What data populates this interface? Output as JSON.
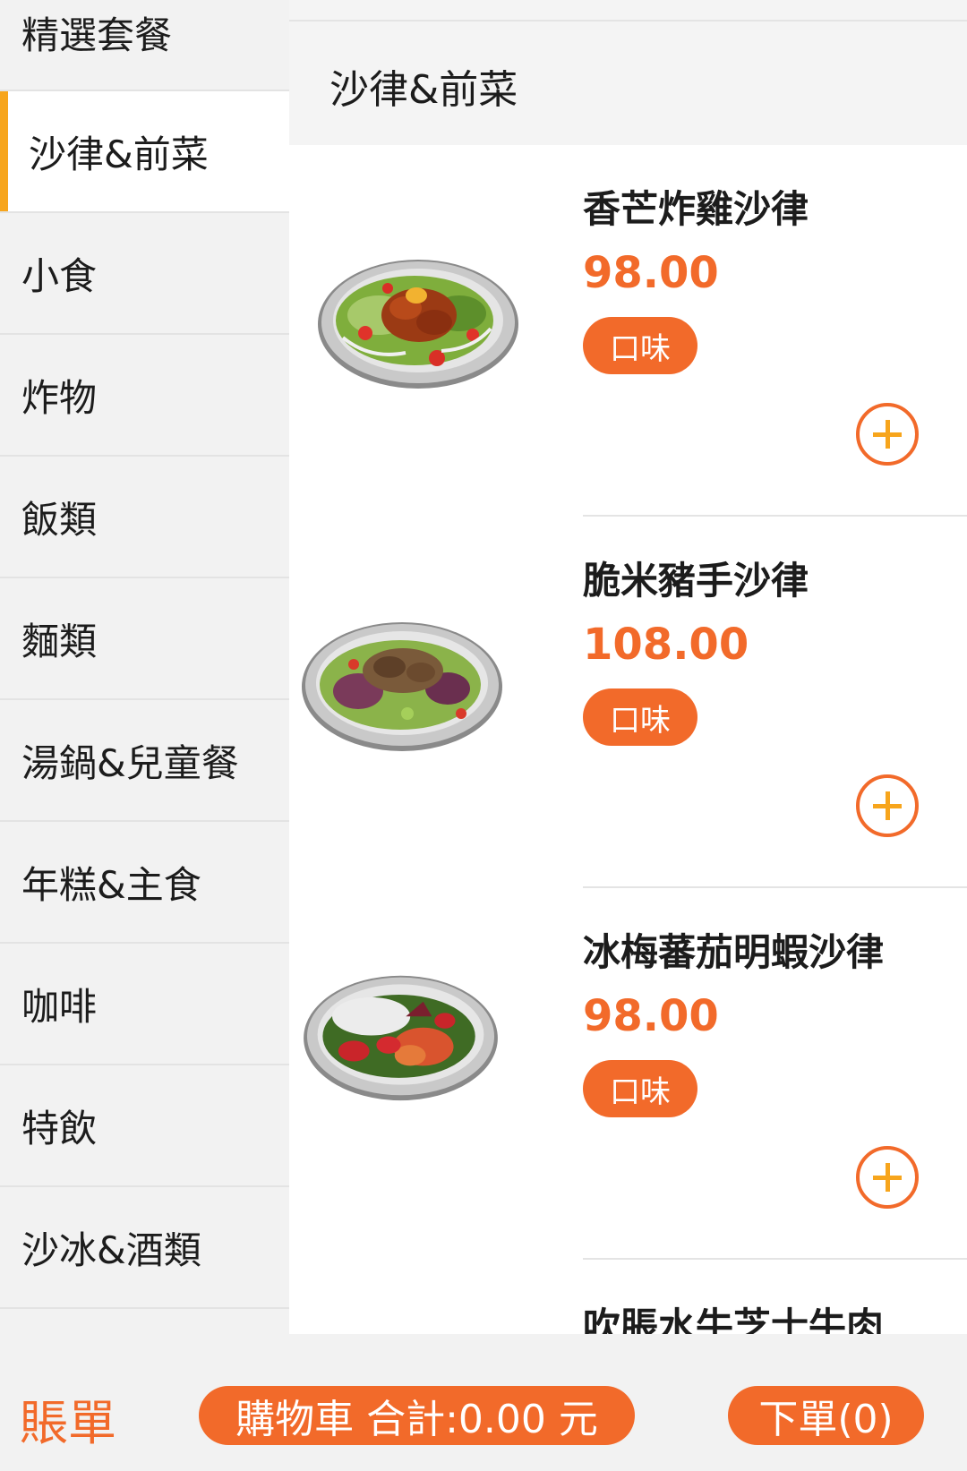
{
  "sidebar": {
    "items": [
      {
        "label": "精選套餐"
      },
      {
        "label": "沙律&前菜"
      },
      {
        "label": "小食"
      },
      {
        "label": "炸物"
      },
      {
        "label": "飯類"
      },
      {
        "label": "麵類"
      },
      {
        "label": "湯鍋&兒童餐"
      },
      {
        "label": "年糕&主食"
      },
      {
        "label": "咖啡"
      },
      {
        "label": "特飲"
      },
      {
        "label": "沙冰&酒類"
      }
    ],
    "active_index": 1
  },
  "section": {
    "title": "沙律&前菜"
  },
  "products": [
    {
      "name": "香芒炸雞沙律",
      "price": "98.00",
      "flavor_label": "口味",
      "image": "salad-fried-chicken-mango"
    },
    {
      "name": "脆米豬手沙律",
      "price": "108.00",
      "flavor_label": "口味",
      "image": "salad-pork-knuckle"
    },
    {
      "name": "冰梅蕃茄明蝦沙律",
      "price": "98.00",
      "flavor_label": "口味",
      "image": "salad-prawn-tomato"
    },
    {
      "name": "吹脹水牛芝士牛肉"
    }
  ],
  "bottom": {
    "bill_label": "賬單",
    "cart_label": "購物車 合計:0.00 元",
    "order_label": "下單(0)"
  },
  "colors": {
    "accent": "#f26a2a",
    "active_bar": "#f7a51c"
  }
}
